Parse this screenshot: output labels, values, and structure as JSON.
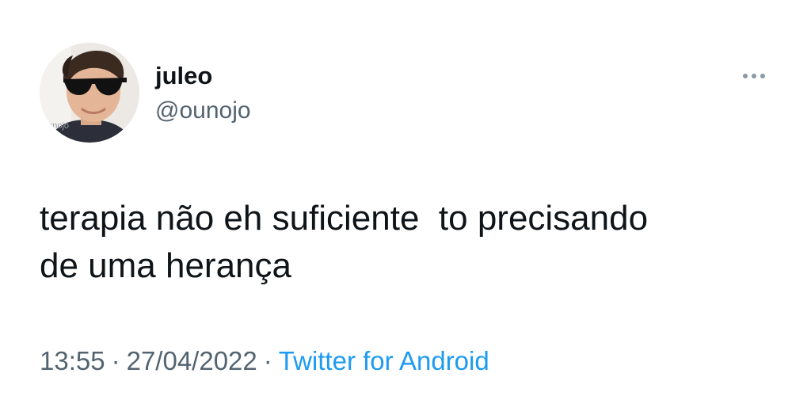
{
  "tweet": {
    "display_name": "juleo",
    "handle": "@ounojo",
    "avatar_watermark": "ounojo",
    "more_icon": "more-horizontal-icon",
    "text_line1": "terapia não eh suficiente  to precisando",
    "text_line2": "de uma herança",
    "time": "13:55",
    "separator": "·",
    "date": "27/04/2022",
    "source": "Twitter for Android"
  },
  "colors": {
    "text": "#0f1419",
    "secondary": "#536471",
    "link": "#1d9bf0",
    "dots": "#8b98a5"
  }
}
